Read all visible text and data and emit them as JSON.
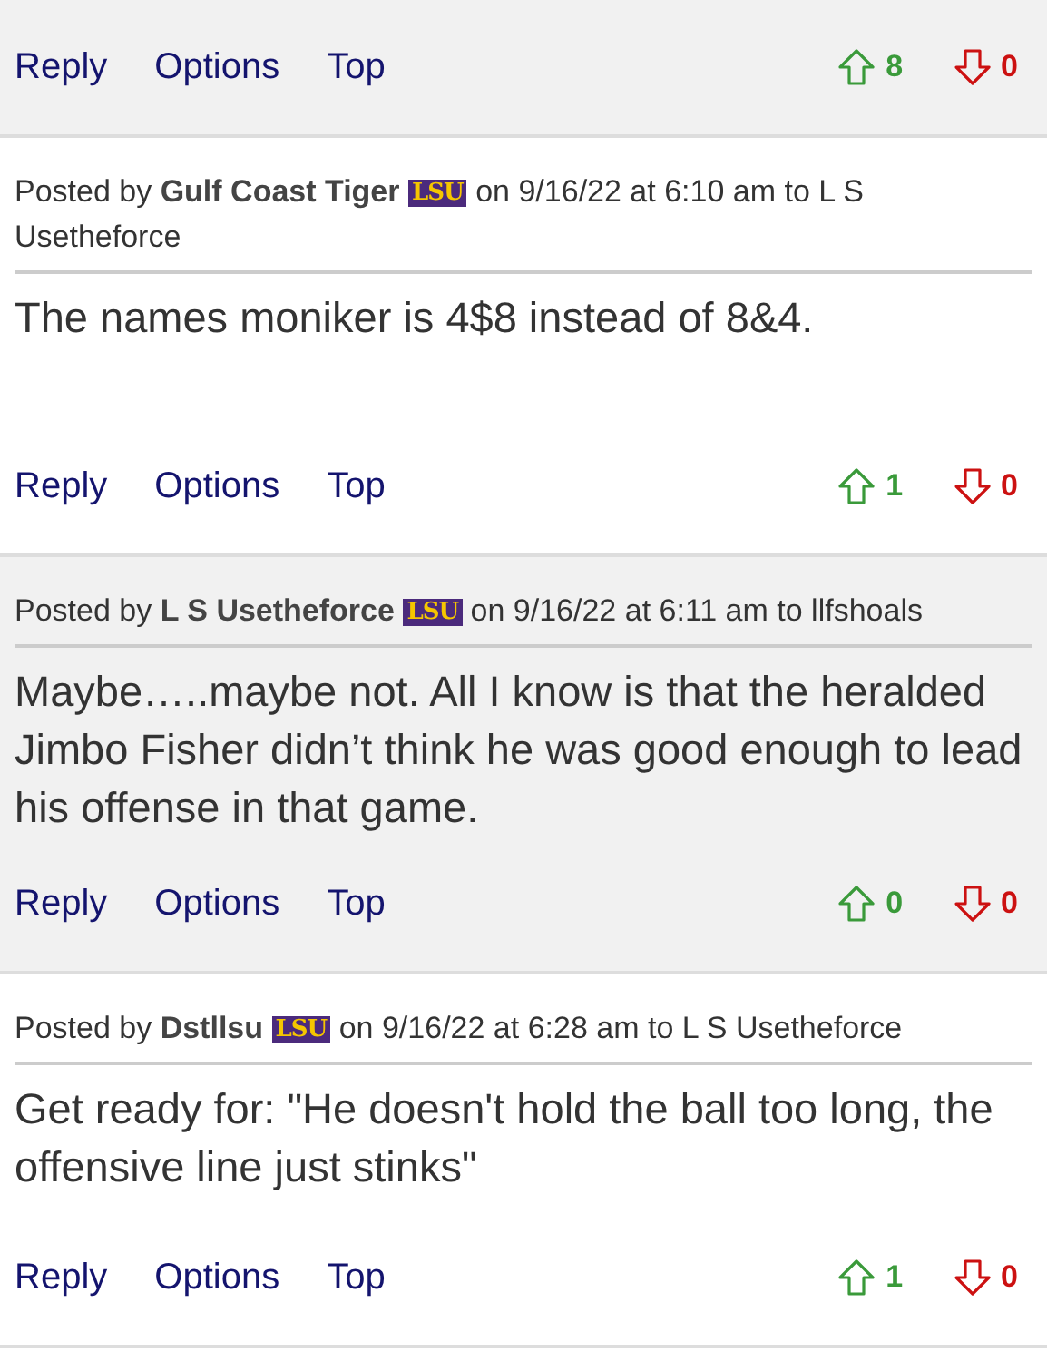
{
  "posts": [
    {
      "shaded": true,
      "actions": {
        "reply": "Reply",
        "options": "Options",
        "top": "Top",
        "upvotes": "8",
        "downvotes": "0"
      }
    },
    {
      "shaded": false,
      "meta": {
        "prefix": "Posted by",
        "author": "Gulf Coast Tiger",
        "badge": "LSU",
        "details": "on 9/16/22 at 6:10 am to L S Usetheforce"
      },
      "body": "The names moniker is 4$8 instead of 8&4.",
      "actions": {
        "reply": "Reply",
        "options": "Options",
        "top": "Top",
        "upvotes": "1",
        "downvotes": "0"
      }
    },
    {
      "shaded": true,
      "meta": {
        "prefix": "Posted by",
        "author": "L S Usetheforce",
        "badge": "LSU",
        "details": "on 9/16/22 at 6:11 am to llfshoals"
      },
      "body": "Maybe…..maybe not. All I know is that the heralded Jimbo Fisher didn’t think he was good enough to lead his offense in that game.",
      "actions": {
        "reply": "Reply",
        "options": "Options",
        "top": "Top",
        "upvotes": "0",
        "downvotes": "0"
      }
    },
    {
      "shaded": false,
      "meta": {
        "prefix": "Posted by",
        "author": "Dstllsu",
        "badge": "LSU",
        "details": "on 9/16/22 at 6:28 am to L S Usetheforce"
      },
      "body": "Get ready for: \"He doesn't hold the ball too long, the offensive line just stinks\"",
      "actions": {
        "reply": "Reply",
        "options": "Options",
        "top": "Top",
        "upvotes": "1",
        "downvotes": "0"
      }
    }
  ]
}
